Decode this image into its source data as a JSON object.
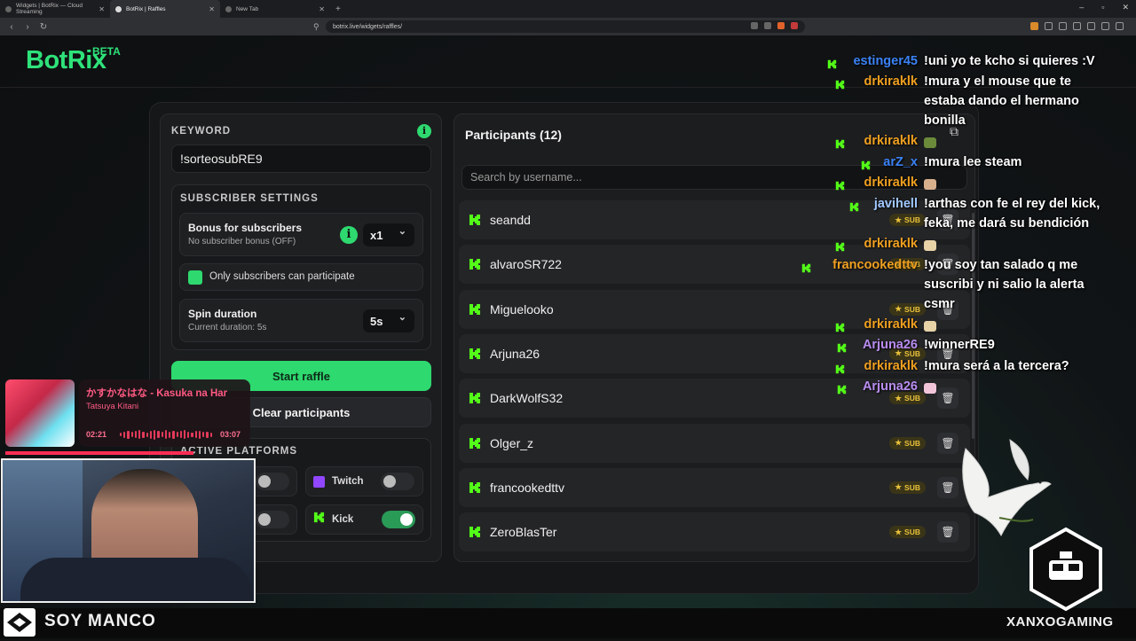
{
  "browser": {
    "tabs": [
      {
        "label": "Widgets | BotRix — Cloud Streaming"
      },
      {
        "label": "BotRix | Raffles"
      },
      {
        "label": "New Tab"
      }
    ],
    "url": "botrix.live/widgets/raffles/"
  },
  "logo": {
    "name": "BotRix",
    "badge": "BETA"
  },
  "keyword": {
    "label": "KEYWORD",
    "value": "!sorteosubRE9"
  },
  "subscriber_settings": {
    "label": "SUBSCRIBER SETTINGS",
    "bonus_title": "Bonus for subscribers",
    "bonus_sub": "No subscriber bonus (OFF)",
    "bonus_value": "x1",
    "only_subs": "Only subscribers can participate",
    "spin_title": "Spin duration",
    "spin_sub": "Current duration: 5s",
    "spin_value": "5s"
  },
  "buttons": {
    "start": "Start raffle",
    "clear": "Clear participants"
  },
  "platforms": {
    "label": "ACTIVE PLATFORMS",
    "twitch": "Twitch",
    "kick": "Kick"
  },
  "participants": {
    "title": "Participants (12)",
    "search_placeholder": "Search by username...",
    "sub_badge": "SUB",
    "rows": [
      {
        "name": "seandd"
      },
      {
        "name": "alvaroSR722"
      },
      {
        "name": "Miguelooko"
      },
      {
        "name": "Arjuna26"
      },
      {
        "name": "DarkWolfS32"
      },
      {
        "name": "Olger_z"
      },
      {
        "name": "francookedttv"
      },
      {
        "name": "ZeroBlasTer"
      }
    ]
  },
  "chat": [
    {
      "user": "estinger45",
      "color": "#3b82f6",
      "text": "!uni yo te kcho si quieres :V"
    },
    {
      "user": "drkiraklk",
      "color": "#f0a020",
      "text": "!mura y el mouse que te"
    },
    {
      "user": "",
      "color": "",
      "text": "estaba dando el hermano"
    },
    {
      "user": "",
      "color": "",
      "text": "bonilla"
    },
    {
      "user": "drkiraklk",
      "color": "#f0a020",
      "text": ""
    },
    {
      "user": "arZ_x",
      "color": "#3b82f6",
      "text": "!mura lee steam"
    },
    {
      "user": "drkiraklk",
      "color": "#f0a020",
      "text": ""
    },
    {
      "user": "javihell",
      "color": "#9fc6ff",
      "text": "!arthas con fe el rey del kick,"
    },
    {
      "user": "",
      "color": "",
      "text": "feka, me dará su bendición"
    },
    {
      "user": "drkiraklk",
      "color": "#f0a020",
      "text": ""
    },
    {
      "user": "francookedttv",
      "color": "#f0a020",
      "text": "!you soy tan salado q me"
    },
    {
      "user": "",
      "color": "",
      "text": "suscribi y ni salio la alerta"
    },
    {
      "user": "",
      "color": "",
      "text": "csmr"
    },
    {
      "user": "drkiraklk",
      "color": "#f0a020",
      "text": ""
    },
    {
      "user": "Arjuna26",
      "color": "#b98cf0",
      "text": "!winnerRE9"
    },
    {
      "user": "drkiraklk",
      "color": "#f0a020",
      "text": "!mura será a la tercera?"
    },
    {
      "user": "Arjuna26",
      "color": "#b98cf0",
      "text": ""
    }
  ],
  "music": {
    "title": "かすかなはな - Kasuka na Har",
    "artist": "Tatsuya Kitani",
    "current": "02:21",
    "total": "03:07"
  },
  "overlay": {
    "streamer": "SOY MANCO",
    "brand": "XANXOGAMING"
  },
  "colors": {
    "accent": "#2ee27a",
    "sub_badge": "#e8c13a",
    "music": "#ff5a83"
  }
}
